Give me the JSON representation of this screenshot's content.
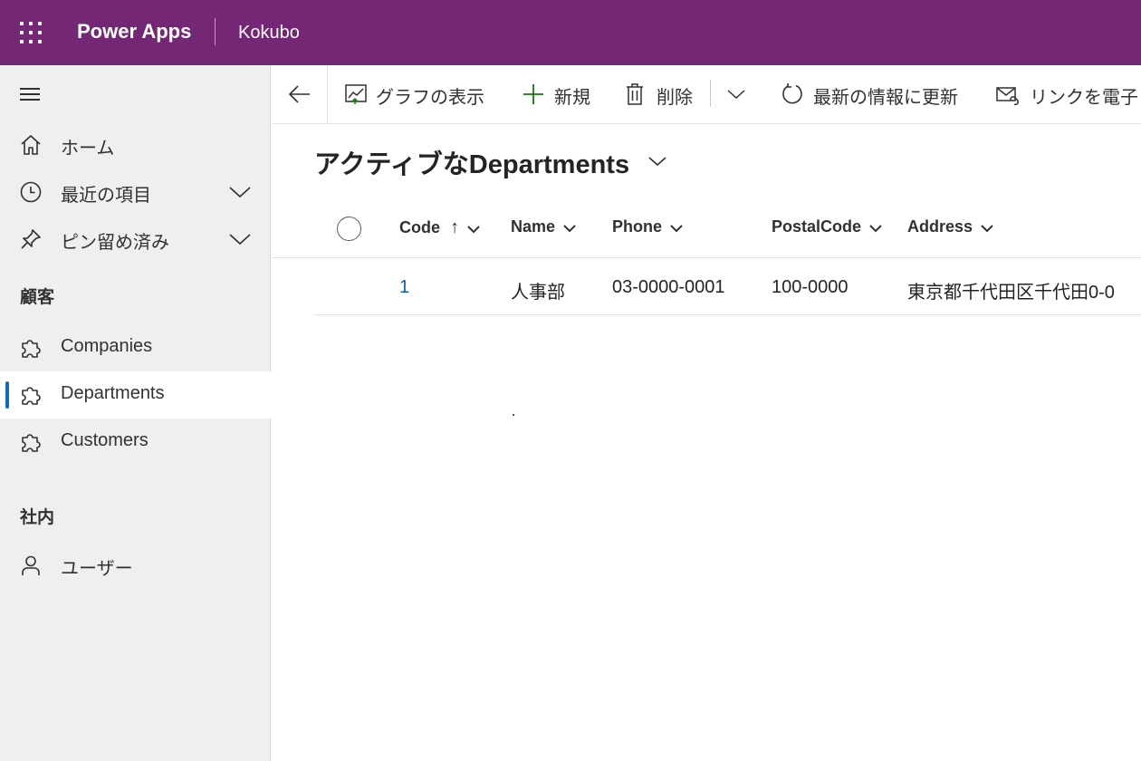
{
  "header": {
    "app_name": "Power Apps",
    "environment": "Kokubo",
    "brand_color": "#742774"
  },
  "sidebar": {
    "menu_icon": "hamburger-icon",
    "items": [
      {
        "label": "ホーム",
        "icon": "home-icon"
      },
      {
        "label": "最近の項目",
        "icon": "clock-icon",
        "expandable": true
      },
      {
        "label": "ピン留め済み",
        "icon": "pin-icon",
        "expandable": true
      }
    ],
    "groups": [
      {
        "title": "顧客",
        "items": [
          {
            "label": "Companies",
            "icon": "puzzle-icon"
          },
          {
            "label": "Departments",
            "icon": "puzzle-icon",
            "selected": true
          },
          {
            "label": "Customers",
            "icon": "puzzle-icon"
          }
        ]
      },
      {
        "title": "社内",
        "items": [
          {
            "label": "ユーザー",
            "icon": "person-icon"
          }
        ]
      }
    ]
  },
  "commandbar": {
    "back": "back-arrow-icon",
    "show_chart": "グラフの表示",
    "new": "新規",
    "delete": "削除",
    "refresh": "最新の情報に更新",
    "email_link": "リンクを電子"
  },
  "view": {
    "title": "アクティブなDepartments",
    "columns": [
      "Code",
      "Name",
      "Phone",
      "PostalCode",
      "Address"
    ],
    "sort_indicator": "↑",
    "rows": [
      {
        "code": "1",
        "name": "人事部",
        "phone": "03-0000-0001",
        "postal": "100-0000",
        "address": "東京都千代田区千代田0-0"
      }
    ]
  }
}
